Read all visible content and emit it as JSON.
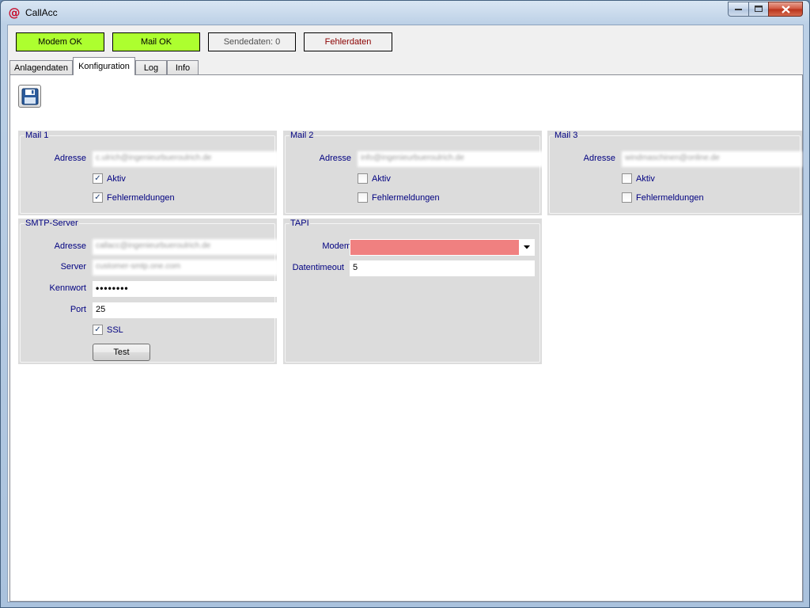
{
  "window": {
    "title": "CallAcc",
    "app_icon": "@"
  },
  "status": {
    "modem": "Modem OK",
    "mail": "Mail OK",
    "sendedaten": "Sendedaten: 0",
    "fehlerdaten": "Fehlerdaten",
    "ok_color": "#adff2f"
  },
  "tabs": [
    "Anlagendaten",
    "Konfiguration",
    "Log",
    "Info"
  ],
  "active_tab": "Konfiguration",
  "mail1": {
    "title": "Mail 1",
    "adresse_label": "Adresse",
    "adresse": "c.ulrich@ingenieurbueroulrich.de",
    "aktiv_label": "Aktiv",
    "aktiv": true,
    "fehler_label": "Fehlermeldungen",
    "fehler": true
  },
  "mail2": {
    "title": "Mail 2",
    "adresse_label": "Adresse",
    "adresse": "info@ingenieurbueroulrich.de",
    "aktiv_label": "Aktiv",
    "aktiv": false,
    "fehler_label": "Fehlermeldungen",
    "fehler": false
  },
  "mail3": {
    "title": "Mail 3",
    "adresse_label": "Adresse",
    "adresse": "windmaschinen@online.de",
    "aktiv_label": "Aktiv",
    "aktiv": false,
    "fehler_label": "Fehlermeldungen",
    "fehler": false
  },
  "smtp": {
    "title": "SMTP-Server",
    "adresse_label": "Adresse",
    "adresse": "callacc@ingenieurbueroulrich.de",
    "server_label": "Server",
    "server": "customer-smtp.one.com",
    "kennwort_label": "Kennwort",
    "kennwort": "••••••••",
    "port_label": "Port",
    "port": "25",
    "ssl_label": "SSL",
    "ssl": true,
    "test_label": "Test"
  },
  "tapi": {
    "title": "TAPI",
    "modem_label": "Modem",
    "modem_value": "",
    "modem_color": "#f08080",
    "timeout_label": "Datentimeout",
    "timeout": "5"
  },
  "icons": {
    "save": "floppy-disk-icon",
    "check": "✓"
  }
}
